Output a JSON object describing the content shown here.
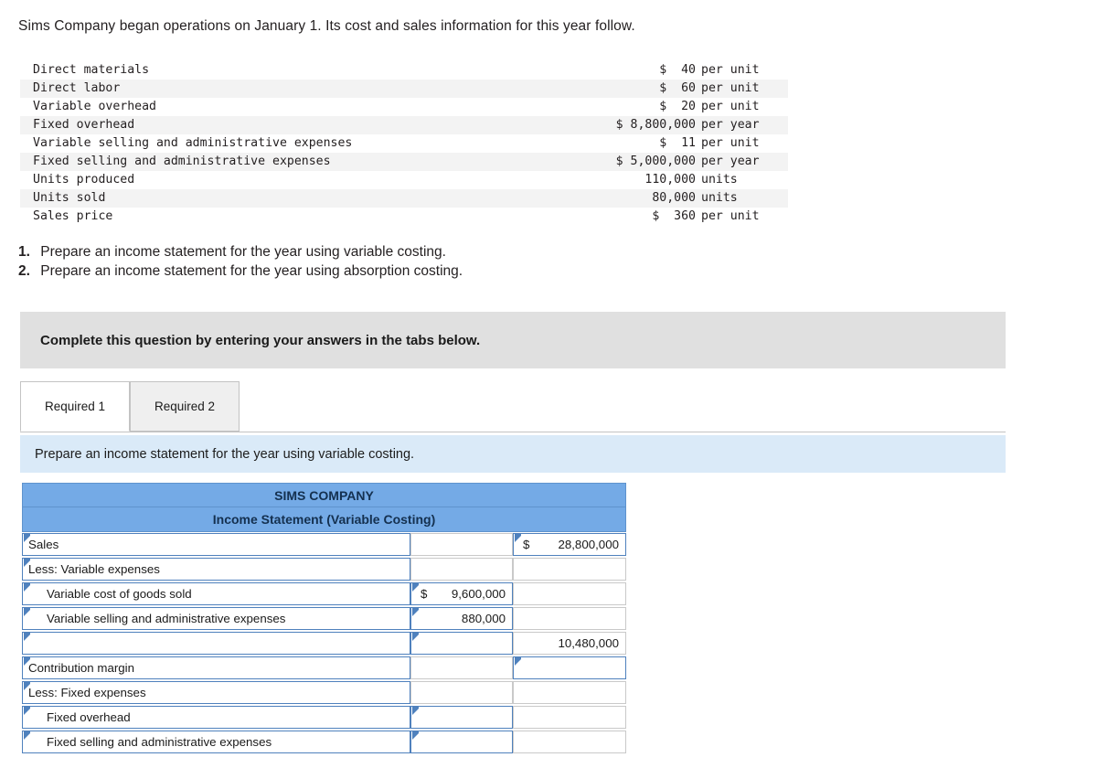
{
  "intro": "Sims Company began operations on January 1. Its cost and sales information for this year follow.",
  "facts": {
    "rows": [
      {
        "label": "Direct materials",
        "amount": "$  40",
        "unit": "per unit"
      },
      {
        "label": "Direct labor",
        "amount": "$  60",
        "unit": "per unit"
      },
      {
        "label": "Variable overhead",
        "amount": "$  20",
        "unit": "per unit"
      },
      {
        "label": "Fixed overhead",
        "amount": "$ 8,800,000",
        "unit": "per year"
      },
      {
        "label": "Variable selling and administrative expenses",
        "amount": "$  11",
        "unit": "per unit"
      },
      {
        "label": "Fixed selling and administrative expenses",
        "amount": "$ 5,000,000",
        "unit": "per year"
      },
      {
        "label": "Units produced",
        "amount": "110,000",
        "unit": "units"
      },
      {
        "label": "Units sold",
        "amount": "80,000",
        "unit": "units"
      },
      {
        "label": "Sales price",
        "amount": "$  360",
        "unit": "per unit"
      }
    ]
  },
  "requirements": [
    {
      "num": "1.",
      "text": "Prepare an income statement for the year using variable costing."
    },
    {
      "num": "2.",
      "text": "Prepare an income statement for the year using absorption costing."
    }
  ],
  "banner": {
    "text": "Complete this question by entering your answers in the tabs below."
  },
  "tabs": [
    {
      "label": "Required 1",
      "active": true
    },
    {
      "label": "Required 2",
      "active": false
    }
  ],
  "prompt": {
    "text": "Prepare an income statement for the year using variable costing."
  },
  "statement": {
    "title": "SIMS COMPANY",
    "subtitle": "Income Statement (Variable Costing)",
    "rows": [
      {
        "label": "Sales",
        "indent": false,
        "mid": "",
        "right": "$  28,800,000"
      },
      {
        "label": "Less: Variable expenses",
        "indent": false,
        "mid": "",
        "right": ""
      },
      {
        "label": "Variable cost of goods sold",
        "indent": true,
        "mid": "$  9,600,000",
        "right": ""
      },
      {
        "label": "Variable selling and administrative expenses",
        "indent": true,
        "mid": "880,000",
        "right": ""
      },
      {
        "label": "",
        "indent": false,
        "mid": "",
        "right": "10,480,000"
      },
      {
        "label": "Contribution margin",
        "indent": false,
        "mid": "",
        "right": ""
      },
      {
        "label": "Less: Fixed expenses",
        "indent": false,
        "mid": "",
        "right": ""
      },
      {
        "label": "Fixed overhead",
        "indent": true,
        "mid": "",
        "right": ""
      },
      {
        "label": "Fixed selling and administrative expenses",
        "indent": true,
        "mid": "",
        "right": ""
      }
    ]
  },
  "colors": {
    "header_blue": "#74aae6",
    "prompt_blue": "#daeaf8",
    "banner_grey": "#e0e0e0",
    "input_border": "#4f81bd"
  }
}
